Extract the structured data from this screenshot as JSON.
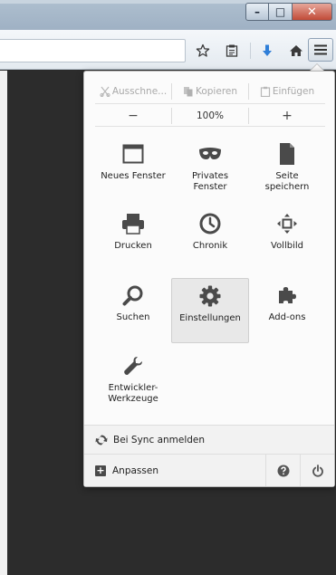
{
  "window": {
    "minimize_glyph": "–",
    "maximize_glyph": "□",
    "close_glyph": "✕"
  },
  "toolbar": {
    "icons": [
      "star-bookmark-icon",
      "reading-list-icon",
      "download-arrow-icon",
      "home-icon"
    ],
    "menu_icon": "hamburger-menu-icon"
  },
  "menu": {
    "edit": {
      "cut": "Ausschne...",
      "copy": "Kopieren",
      "paste": "Einfügen"
    },
    "zoom": {
      "out": "−",
      "level": "100%",
      "in": "+"
    },
    "items": [
      {
        "label": "Neues Fenster",
        "icon": "window-icon"
      },
      {
        "label": "Privates\nFenster",
        "icon": "mask-icon"
      },
      {
        "label": "Seite\nspeichern",
        "icon": "page-icon"
      },
      {
        "label": "Drucken",
        "icon": "printer-icon"
      },
      {
        "label": "Chronik",
        "icon": "clock-icon"
      },
      {
        "label": "Vollbild",
        "icon": "fullscreen-icon"
      },
      {
        "label": "Suchen",
        "icon": "magnifier-icon"
      },
      {
        "label": "Einstellungen",
        "icon": "gear-icon",
        "selected": true
      },
      {
        "label": "Add-ons",
        "icon": "puzzle-icon"
      },
      {
        "label": "Entwickler-\nWerkzeuge",
        "icon": "wrench-icon"
      }
    ],
    "sync_label": "Bei Sync anmelden",
    "customize_label": "Anpassen",
    "help_icon": "help-icon",
    "quit_icon": "power-icon"
  },
  "colors": {
    "accent_blue": "#2f7fd8",
    "panel_bg": "#fbfbfb",
    "icon_dark": "#4a4a4a"
  }
}
